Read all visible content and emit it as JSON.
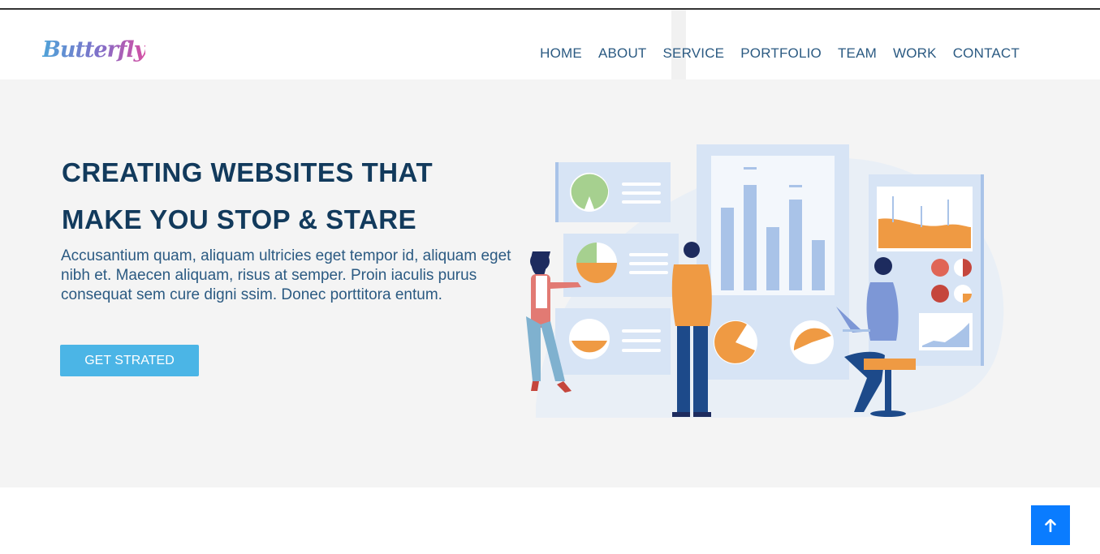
{
  "brand": {
    "logo_text": "Butterfly"
  },
  "nav": {
    "items": [
      "HOME",
      "ABOUT",
      "SERVICE",
      "PORTFOLIO",
      "TEAM",
      "WORK",
      "CONTACT"
    ]
  },
  "hero": {
    "headline_line1": "CREATING WEBSITES THAT",
    "headline_line2": "MAKE YOU STOP & STARE",
    "lead": "Accusantium quam, aliquam ultricies eget tempor id, aliquam eget nibh et. Maecen aliquam, risus at semper. Proin iaculis purus consequat sem cure digni ssim. Donec porttitora entum.",
    "cta_label": "GET STRATED"
  },
  "icons": {
    "back_to_top": "arrow-up-icon"
  },
  "colors": {
    "accent": "#4bb5e6",
    "heading": "#123a5c",
    "text": "#2b5a82",
    "back_to_top": "#0a7cff",
    "hero_bg": "#f4f4f4"
  }
}
